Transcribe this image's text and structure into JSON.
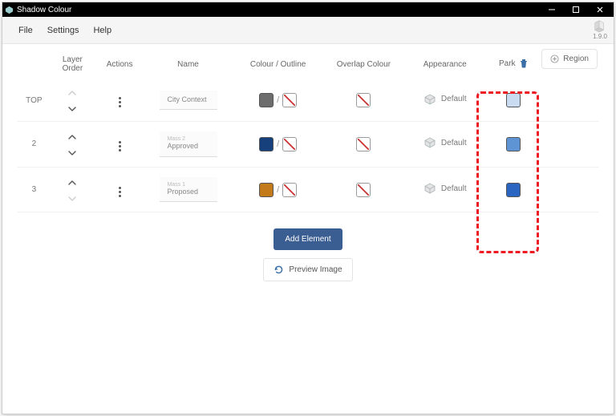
{
  "app": {
    "title": "Shadow Colour",
    "version": "1.9.0"
  },
  "menu": {
    "file": "File",
    "settings": "Settings",
    "help": "Help"
  },
  "columns": {
    "layer_order": "Layer Order",
    "actions": "Actions",
    "name": "Name",
    "colour_outline": "Colour / Outline",
    "overlap_colour": "Overlap Colour",
    "appearance": "Appearance",
    "park": "Park"
  },
  "buttons": {
    "region": "Region",
    "add_element": "Add Element",
    "preview_image": "Preview Image"
  },
  "rows": [
    {
      "idx": "TOP",
      "name_sub": "",
      "name_main": "City Context",
      "fill": "#6d6d6d",
      "outline": "none",
      "overlap": "none",
      "appearance": "Default",
      "park_fill": "#c8dbf0",
      "up_enabled": false,
      "down_enabled": true
    },
    {
      "idx": "2",
      "name_sub": "Mass 2",
      "name_main": "Approved",
      "fill": "#16407b",
      "outline": "none",
      "overlap": "none",
      "appearance": "Default",
      "park_fill": "#5e94d4",
      "up_enabled": true,
      "down_enabled": true
    },
    {
      "idx": "3",
      "name_sub": "Mass 1",
      "name_main": "Proposed",
      "fill": "#c27a1a",
      "outline": "none",
      "overlap": "none",
      "appearance": "Default",
      "park_fill": "#2965c1",
      "up_enabled": true,
      "down_enabled": false
    }
  ]
}
